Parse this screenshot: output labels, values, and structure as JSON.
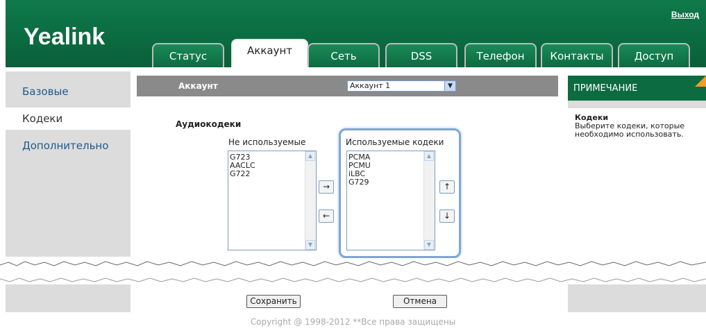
{
  "header": {
    "brand": "Yealink",
    "logout_label": "Выход",
    "tabs": [
      {
        "label": "Статус"
      },
      {
        "label": "Аккаунт"
      },
      {
        "label": "Сеть"
      },
      {
        "label": "DSS"
      },
      {
        "label": "Телефон"
      },
      {
        "label": "Контакты"
      },
      {
        "label": "Доступ"
      }
    ],
    "active_tab": "Аккаунт"
  },
  "sidebar": {
    "items": [
      {
        "label": "Базовые"
      },
      {
        "label": "Кодеки"
      },
      {
        "label": "Дополнительно"
      }
    ],
    "active_item": "Кодеки"
  },
  "account_bar": {
    "label": "Аккаунт",
    "selected": "Аккаунт 1"
  },
  "codecs": {
    "section_title": "Аудиокодеки",
    "unused": {
      "title": "Не используемые",
      "items": [
        "G723",
        "AACLC",
        "G722"
      ]
    },
    "used": {
      "title": "Используемые кодеки",
      "items": [
        "PCMA",
        "PCMU",
        "iLBC",
        "G729"
      ]
    },
    "move_right": "→",
    "move_left": "←",
    "move_up": "↑",
    "move_down": "↓"
  },
  "note": {
    "heading": "ПРИМЕЧАНИЕ",
    "title": "Кодеки",
    "text": "Выберите кодеки, которые необходимо использовать."
  },
  "actions": {
    "save_label": "Сохранить",
    "cancel_label": "Отмена"
  },
  "footer": {
    "copyright": "Copyright @ 1998-2012 **Все права защищены"
  },
  "colors": {
    "brand_green": "#0c6b41",
    "accent_orange": "#f39c2b",
    "highlight_blue": "#7fa6d0"
  }
}
